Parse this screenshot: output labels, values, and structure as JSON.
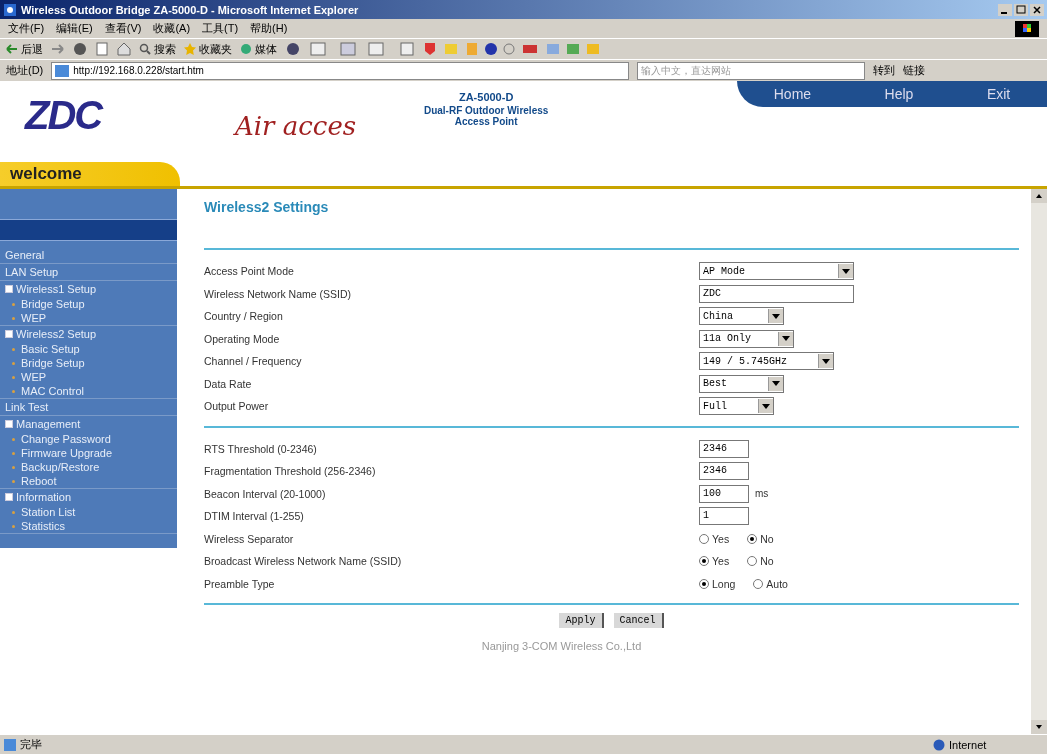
{
  "window": {
    "title": "Wireless Outdoor Bridge ZA-5000-D - Microsoft Internet Explorer"
  },
  "menu": [
    "文件(F)",
    "编辑(E)",
    "查看(V)",
    "收藏(A)",
    "工具(T)",
    "帮助(H)"
  ],
  "toolbar": {
    "back": "后退",
    "search": "搜索",
    "favorites": "收藏夹",
    "media": "媒体"
  },
  "address_bar": {
    "label": "地址(D)",
    "url": "http://192.168.0.228/start.htm",
    "search_placeholder": "输入中文，直达网站",
    "go": "转到",
    "links": "链接"
  },
  "header": {
    "logo": "ZDC",
    "brand": "Air acces",
    "model": "ZA-5000-D",
    "subtitle": "Dual-RF Outdoor Wireless Access Point",
    "welcome": "welcome",
    "nav": [
      "Home",
      "Help",
      "Exit"
    ]
  },
  "sidebar": {
    "items": [
      {
        "label": "General"
      },
      {
        "label": "LAN Setup"
      },
      {
        "label": "Wireless1 Setup",
        "children": [
          {
            "label": "Bridge Setup"
          },
          {
            "label": "WEP"
          }
        ]
      },
      {
        "label": "Wireless2 Setup",
        "children": [
          {
            "label": "Basic Setup"
          },
          {
            "label": "Bridge Setup"
          },
          {
            "label": "WEP"
          },
          {
            "label": "MAC Control"
          }
        ]
      },
      {
        "label": "Link Test"
      },
      {
        "label": "Management",
        "children": [
          {
            "label": "Change Password"
          },
          {
            "label": "Firmware Upgrade"
          },
          {
            "label": "Backup/Restore"
          },
          {
            "label": "Reboot"
          }
        ]
      },
      {
        "label": "Information",
        "children": [
          {
            "label": "Station List"
          },
          {
            "label": "Statistics"
          }
        ]
      }
    ]
  },
  "page_title": "Wireless2 Settings",
  "sections": [
    [
      {
        "kind": "select",
        "label": "Access Point Mode",
        "value": "AP Mode"
      },
      {
        "kind": "text",
        "label": "Wireless Network Name (SSID)",
        "value": "ZDC"
      },
      {
        "kind": "select",
        "label": "Country / Region",
        "value": "China"
      },
      {
        "kind": "select",
        "label": "Operating Mode",
        "value": "11a Only"
      },
      {
        "kind": "select",
        "label": "Channel / Frequency",
        "value": "149 / 5.745GHz"
      },
      {
        "kind": "select",
        "label": "Data Rate",
        "value": "Best"
      },
      {
        "kind": "select",
        "label": "Output Power",
        "value": "Full"
      }
    ],
    [
      {
        "kind": "text",
        "label": "RTS Threshold (0-2346)",
        "value": "2346"
      },
      {
        "kind": "text",
        "label": "Fragmentation Threshold (256-2346)",
        "value": "2346"
      },
      {
        "kind": "text",
        "label": "Beacon Interval (20-1000)",
        "value": "100",
        "unit": "ms"
      },
      {
        "kind": "text",
        "label": "DTIM Interval (1-255)",
        "value": "1"
      },
      {
        "kind": "radio",
        "label": "Wireless Separator",
        "options": [
          {
            "label": "Yes",
            "selected": false
          },
          {
            "label": "No",
            "selected": true
          }
        ]
      },
      {
        "kind": "radio",
        "label": "Broadcast Wireless Network Name (SSID)",
        "options": [
          {
            "label": "Yes",
            "selected": true
          },
          {
            "label": "No",
            "selected": false
          }
        ]
      },
      {
        "kind": "radio",
        "label": "Preamble Type",
        "options": [
          {
            "label": "Long",
            "selected": true
          },
          {
            "label": "Auto",
            "selected": false
          }
        ]
      }
    ]
  ],
  "buttons": [
    "Apply",
    "Cancel"
  ],
  "footer": "Nanjing 3-COM Wireless Co.,Ltd",
  "status_bar": {
    "text": "完毕",
    "zone": "Internet"
  }
}
